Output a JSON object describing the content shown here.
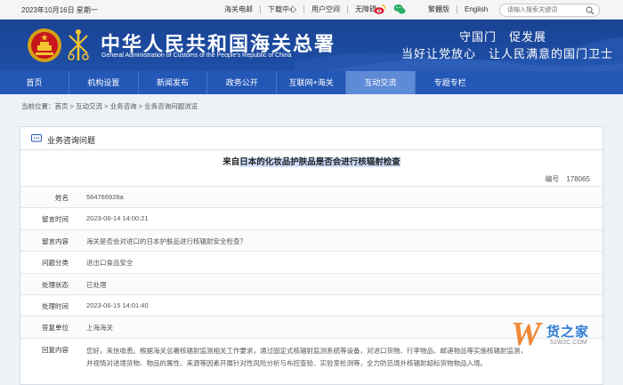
{
  "topbar": {
    "date": "2023年10月16日 星期一",
    "links": [
      "海关电邮",
      "下载中心",
      "用户空间",
      "无障碍"
    ],
    "social_icons": [
      "weibo-icon",
      "wechat-icon"
    ],
    "lang": [
      "繁體版",
      "English"
    ],
    "search_placeholder": "请输入搜索关键词"
  },
  "banner": {
    "title_cn": "中华人民共和国海关总署",
    "title_en": "General Administration of Customs of the People's Republic of China",
    "slogan1": "守国门　促发展",
    "slogan2": "当好让党放心　让人民满意的国门卫士"
  },
  "nav": {
    "items": [
      "首页",
      "机构设置",
      "新闻发布",
      "政务公开",
      "互联网+海关",
      "互动交流",
      "专题专栏"
    ],
    "active_index": 5
  },
  "breadcrumb": "当前位置：首页 > 互动交流 > 业务咨询 > 业务咨询问题浏览",
  "panel": {
    "title": "业务咨询问题",
    "question_prefix": "来自",
    "question_title": "日本的化妆品护肤品是否会进行核辐射检查",
    "number": "编号　178065",
    "rows": {
      "name_label": "姓名",
      "name_value": "564766928a",
      "time_label": "留言时间",
      "time_value": "2023-06-14 14:00:21",
      "content_label": "留言内容",
      "content_value": "海关是否会对进口的日本护肤品进行核辐射安全检查？",
      "category_label": "问题分类",
      "category_value": "进出口食品安全",
      "status_label": "处理状态",
      "status_value": "已处理",
      "processed_label": "处理时间",
      "processed_value": "2023-06-15 14:01:40",
      "unit_label": "答复单位",
      "unit_value": "上海海关",
      "reply_label": "回复内容",
      "reply_value": "您好，来信收悉。根据海关总署核辐射监测相关工作要求，通过固定式核辐射监测系统等设备，对进口货物、行李物品、邮递物品等实施核辐射监测，并视情对进境货物、物品的属性、来源等因素开展针对性风险分析与布控查验、实验室检测等，全力防范境外核辐射超标货物物品入境。"
    }
  },
  "watermark": {
    "letter": "W",
    "text": "货之家",
    "url": "51W2C.COM"
  }
}
